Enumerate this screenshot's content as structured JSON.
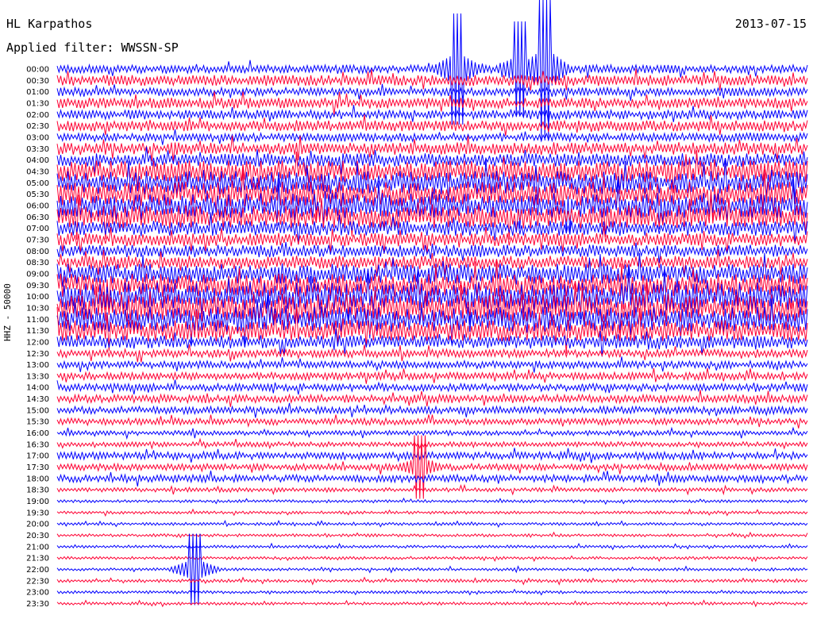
{
  "header": {
    "station": "HL Karpathos",
    "filter": "Applied filter: WWSSN-SP",
    "date": "2013-07-15"
  },
  "chart_data": {
    "type": "line",
    "title": "HL Karpathos",
    "date": "2013-07-15",
    "filter": "WWSSN-SP",
    "ylabel": "HHZ - 50000",
    "trace_colors": [
      "#0000ff",
      "#ff0033"
    ],
    "row_labels": [
      "00:00",
      "00:30",
      "01:00",
      "01:30",
      "02:00",
      "02:30",
      "03:00",
      "03:30",
      "04:00",
      "04:30",
      "05:00",
      "05:30",
      "06:00",
      "06:30",
      "07:00",
      "07:30",
      "08:00",
      "08:30",
      "09:00",
      "09:30",
      "10:00",
      "10:30",
      "11:00",
      "11:30",
      "12:00",
      "12:30",
      "13:00",
      "13:30",
      "14:00",
      "14:30",
      "15:00",
      "15:30",
      "16:00",
      "16:30",
      "17:00",
      "17:30",
      "18:00",
      "18:30",
      "19:00",
      "19:30",
      "20:00",
      "20:30",
      "21:00",
      "21:30",
      "22:00",
      "22:30",
      "23:00",
      "23:30"
    ],
    "row_amplitude": [
      1.0,
      1.3,
      1.0,
      1.3,
      1.1,
      1.3,
      1.0,
      1.5,
      1.6,
      2.6,
      2.8,
      3.0,
      3.0,
      2.8,
      1.8,
      1.6,
      1.5,
      1.6,
      2.4,
      2.8,
      3.4,
      3.4,
      3.0,
      2.6,
      1.6,
      1.0,
      0.9,
      0.9,
      0.9,
      1.0,
      0.9,
      0.8,
      0.6,
      0.6,
      0.9,
      0.8,
      0.9,
      0.5,
      0.35,
      0.35,
      0.35,
      0.35,
      0.35,
      0.35,
      0.35,
      0.4,
      0.35,
      0.35
    ],
    "events": [
      {
        "row_label": "00:00",
        "minutes": 16.0,
        "size": 70
      },
      {
        "row_label": "00:00",
        "minutes": 18.5,
        "size": 60
      },
      {
        "row_label": "00:00",
        "minutes": 19.5,
        "size": 90
      },
      {
        "row_label": "17:30",
        "minutes": 14.5,
        "size": 40
      },
      {
        "row_label": "22:00",
        "minutes": 5.5,
        "size": 45
      }
    ]
  }
}
